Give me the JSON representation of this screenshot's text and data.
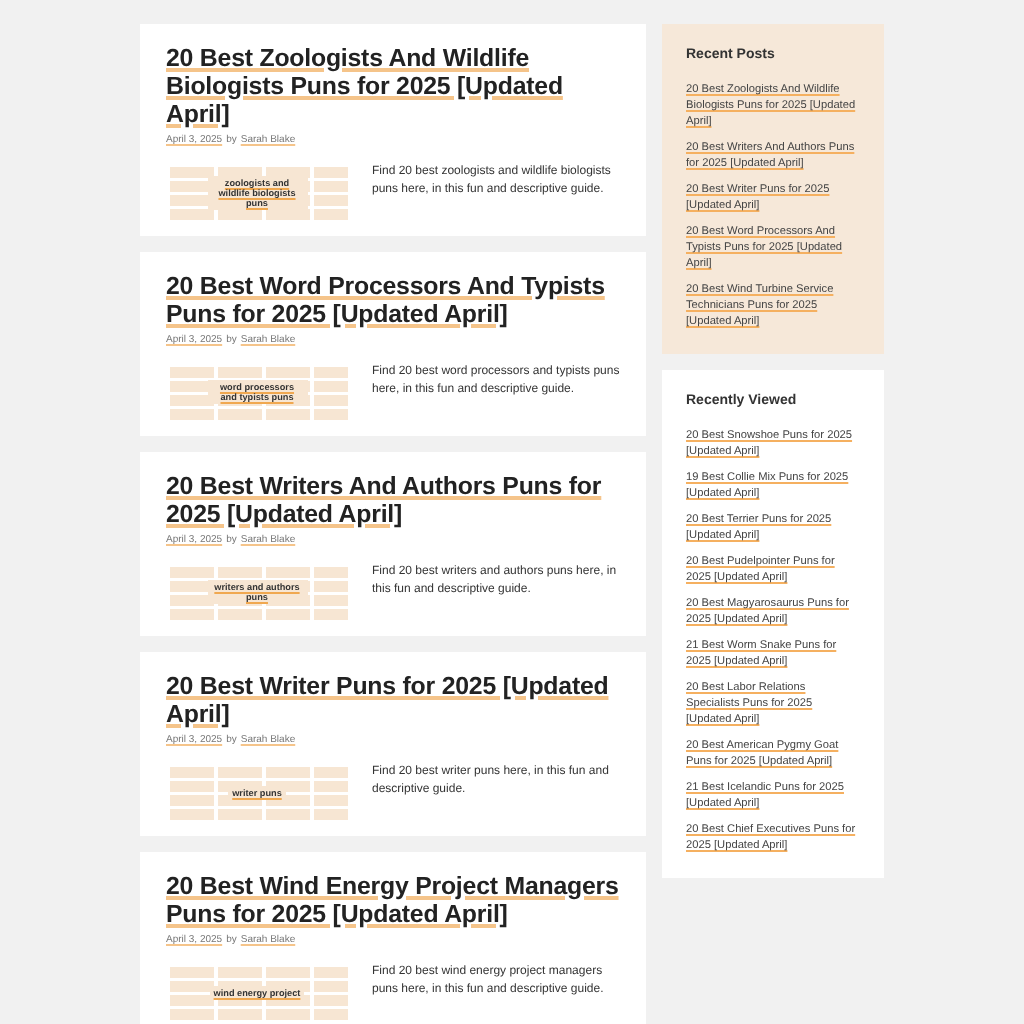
{
  "posts": [
    {
      "title": "20 Best Zoologists And Wildlife Biologists Puns for 2025 [Updated April]",
      "date": "April 3, 2025",
      "by": "by",
      "author": "Sarah Blake",
      "thumb_text": "zoologists and wildlife biologists puns",
      "excerpt": "Find 20 best zoologists and wildlife biologists puns here, in this fun and descriptive guide."
    },
    {
      "title": "20 Best Word Processors And Typists Puns for 2025 [Updated April]",
      "date": "April 3, 2025",
      "by": "by",
      "author": "Sarah Blake",
      "thumb_text": "word processors and typists puns",
      "excerpt": "Find 20 best word processors and typists puns here, in this fun and descriptive guide."
    },
    {
      "title": "20 Best Writers And Authors Puns for 2025 [Updated April]",
      "date": "April 3, 2025",
      "by": "by",
      "author": "Sarah Blake",
      "thumb_text": "writers and authors puns",
      "excerpt": "Find 20 best writers and authors puns here, in this fun and descriptive guide."
    },
    {
      "title": "20 Best Writer Puns for 2025 [Updated April]",
      "date": "April 3, 2025",
      "by": "by",
      "author": "Sarah Blake",
      "thumb_text": "writer puns",
      "excerpt": "Find 20 best writer puns here, in this fun and descriptive guide."
    },
    {
      "title": "20 Best Wind Energy Project Managers Puns for 2025 [Updated April]",
      "date": "April 3, 2025",
      "by": "by",
      "author": "Sarah Blake",
      "thumb_text": "wind energy project",
      "excerpt": "Find 20 best wind energy project managers puns here, in this fun and descriptive guide."
    }
  ],
  "sidebar": [
    {
      "kind": "shaded",
      "title": "Recent Posts",
      "links": [
        "20 Best Zoologists And Wildlife Biologists Puns for 2025 [Updated April]",
        "20 Best Writers And Authors Puns for 2025 [Updated April]",
        "20 Best Writer Puns for 2025 [Updated April]",
        "20 Best Word Processors And Typists Puns for 2025 [Updated April]",
        "20 Best Wind Turbine Service Technicians Puns for 2025 [Updated April]"
      ]
    },
    {
      "kind": "plain",
      "title": "Recently Viewed",
      "links": [
        "20 Best Snowshoe Puns for 2025 [Updated April]",
        "19 Best Collie Mix Puns for 2025 [Updated April]",
        "20 Best Terrier Puns for 2025 [Updated April]",
        "20 Best Pudelpointer Puns for 2025 [Updated April]",
        "20 Best Magyarosaurus Puns for 2025 [Updated April]",
        "21 Best Worm Snake Puns for 2025 [Updated April]",
        "20 Best Labor Relations Specialists Puns for 2025 [Updated April]",
        "20 Best American Pygmy Goat Puns for 2025 [Updated April]",
        "21 Best Icelandic Puns for 2025 [Updated April]",
        "20 Best Chief Executives Puns for 2025 [Updated April]"
      ]
    }
  ]
}
